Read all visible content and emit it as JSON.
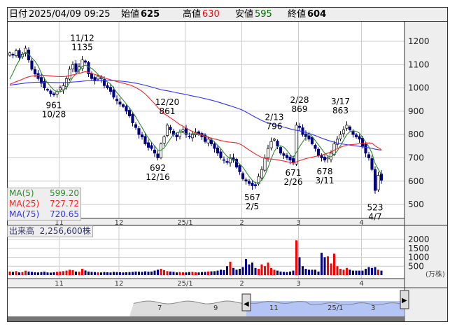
{
  "header": {
    "date_label": "日付",
    "datetime": "2025/04/09 09:25",
    "open_label": "始値",
    "open": "625",
    "high_label": "高値",
    "high": "630",
    "low_label": "安値",
    "low": "595",
    "close_label": "終値",
    "close": "604"
  },
  "colors": {
    "up": "#ff0000",
    "down": "#000080",
    "ma5": "#2e8b2e",
    "ma25": "#ff2020",
    "ma75": "#3030ff",
    "nav_fill": "#b4c4f4"
  },
  "legend": {
    "ma5_label": "MA(5)",
    "ma5": "599.20",
    "ma25_label": "MA(25)",
    "ma25": "727.72",
    "ma75_label": "MA(75)",
    "ma75": "720.65"
  },
  "volume_header": {
    "label": "出来高",
    "value": "2,256,600株"
  },
  "chart_data": {
    "type": "candlestick",
    "price_axis": {
      "ticks": [
        1200,
        1100,
        1000,
        900,
        800,
        700,
        600,
        500
      ],
      "range": [
        440,
        1290
      ]
    },
    "volume_axis": {
      "ticks": [
        2000,
        1500,
        1000,
        500
      ],
      "unit": "(万株)"
    },
    "months": [
      {
        "label": "11",
        "index": 17
      },
      {
        "label": "12",
        "index": 36
      },
      {
        "label": "25/1",
        "index": 57
      },
      {
        "label": "2",
        "index": 75
      },
      {
        "label": "3",
        "index": 93
      },
      {
        "label": "4",
        "index": 113
      }
    ],
    "close": [
      1150,
      1140,
      1160,
      1130,
      1145,
      1170,
      1120,
      1080,
      1060,
      1040,
      1020,
      1000,
      990,
      975,
      970,
      985,
      1000,
      1010,
      1040,
      1080,
      1100,
      1070,
      1090,
      1120,
      1110,
      1060,
      1040,
      1030,
      1050,
      1040,
      1010,
      1000,
      985,
      960,
      945,
      930,
      920,
      900,
      880,
      850,
      830,
      800,
      790,
      760,
      745,
      740,
      720,
      700,
      760,
      790,
      840,
      820,
      800,
      790,
      810,
      820,
      800,
      790,
      800,
      810,
      800,
      790,
      770,
      780,
      760,
      740,
      720,
      700,
      690,
      680,
      700,
      690,
      660,
      640,
      610,
      600,
      590,
      580,
      580,
      620,
      650,
      700,
      740,
      770,
      780,
      750,
      720,
      710,
      700,
      690,
      680,
      840,
      830,
      800,
      790,
      780,
      760,
      740,
      710,
      700,
      690,
      700,
      720,
      760,
      780,
      800,
      820,
      840,
      820,
      800,
      790,
      780,
      750,
      720,
      700,
      650,
      560,
      625,
      604
    ],
    "volume": [
      200,
      180,
      220,
      150,
      170,
      250,
      200,
      180,
      160,
      150,
      170,
      190,
      150,
      140,
      160,
      180,
      200,
      220,
      250,
      300,
      280,
      200,
      190,
      350,
      260,
      200,
      180,
      170,
      160,
      150,
      170,
      160,
      150,
      180,
      170,
      160,
      150,
      160,
      170,
      180,
      200,
      190,
      180,
      210,
      190,
      200,
      250,
      300,
      350,
      280,
      220,
      200,
      180,
      150,
      170,
      160,
      150,
      170,
      180,
      160,
      150,
      170,
      180,
      200,
      210,
      220,
      250,
      300,
      280,
      500,
      750,
      400,
      300,
      350,
      450,
      900,
      600,
      700,
      400,
      350,
      600,
      500,
      700,
      400,
      300,
      250,
      200,
      180,
      170,
      200,
      250,
      1950,
      1000,
      500,
      350,
      300,
      300,
      300,
      200,
      1250,
      1000,
      1050,
      650,
      1200,
      500,
      350,
      300,
      400,
      300,
      250,
      250,
      250,
      250,
      350,
      450,
      400,
      450,
      300,
      250
    ],
    "annotations": [
      {
        "index": 14,
        "value": "961",
        "date": "10/28",
        "pos": "below"
      },
      {
        "index": 23,
        "value": "1135",
        "date": "11/12",
        "pos": "above"
      },
      {
        "index": 47,
        "value": "692",
        "date": "12/16",
        "pos": "below"
      },
      {
        "index": 50,
        "value": "861",
        "date": "12/20",
        "pos": "above"
      },
      {
        "index": 77,
        "value": "567",
        "date": "2/5",
        "pos": "below"
      },
      {
        "index": 84,
        "value": "796",
        "date": "2/13",
        "pos": "above"
      },
      {
        "index": 90,
        "value": "671",
        "date": "2/26",
        "pos": "below"
      },
      {
        "index": 92,
        "value": "869",
        "date": "2/28",
        "pos": "above"
      },
      {
        "index": 100,
        "value": "678",
        "date": "3/11",
        "pos": "below"
      },
      {
        "index": 105,
        "value": "863",
        "date": "3/17",
        "pos": "above"
      },
      {
        "index": 116,
        "value": "523",
        "date": "4/7",
        "pos": "below"
      }
    ],
    "navigator_labels": [
      "7",
      "9",
      "11",
      "25/1",
      "3"
    ]
  }
}
